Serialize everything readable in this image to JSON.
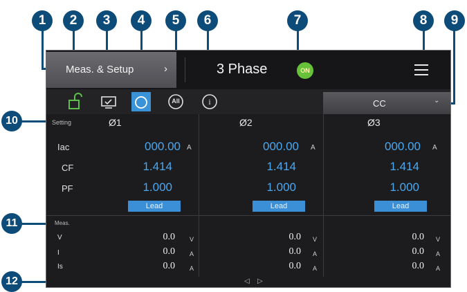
{
  "header": {
    "meas_setup_label": "Meas. & Setup",
    "chevron": "›",
    "title": "3 Phase",
    "on_badge": "ON"
  },
  "toolbar": {
    "icons": [
      "unlock-icon",
      "monitor-icon",
      "timer-icon",
      "all-icon",
      "info-icon"
    ],
    "all_label": "All",
    "info_label": "i",
    "mode_value": "CC",
    "mode_dropdown": "⌄"
  },
  "setting": {
    "section_label": "Setting",
    "row_labels": [
      "Iac",
      "CF",
      "PF"
    ],
    "phases": [
      {
        "name": "Ø1",
        "iac": "000.00",
        "iac_unit": "A",
        "cf": "1.414",
        "pf": "1.000",
        "lead": "Lead"
      },
      {
        "name": "Ø2",
        "iac": "000.00",
        "iac_unit": "A",
        "cf": "1.414",
        "pf": "1.000",
        "lead": "Lead"
      },
      {
        "name": "Ø3",
        "iac": "000.00",
        "iac_unit": "A",
        "cf": "1.414",
        "pf": "1.000",
        "lead": "Lead"
      }
    ]
  },
  "meas": {
    "section_label": "Meas.",
    "row_labels": [
      "V",
      "I",
      "Is"
    ],
    "phases": [
      {
        "v": "0.0",
        "v_unit": "V",
        "i": "0.0",
        "i_unit": "A",
        "is": "0.0",
        "is_unit": "A"
      },
      {
        "v": "0.0",
        "v_unit": "V",
        "i": "0.0",
        "i_unit": "A",
        "is": "0.0",
        "is_unit": "A"
      },
      {
        "v": "0.0",
        "v_unit": "V",
        "i": "0.0",
        "i_unit": "A",
        "is": "0.0",
        "is_unit": "A"
      }
    ]
  },
  "scroll": {
    "left": "◁",
    "right": "▷"
  },
  "callouts": [
    "1",
    "2",
    "3",
    "4",
    "5",
    "6",
    "7",
    "8",
    "9",
    "10",
    "11",
    "12"
  ],
  "colors": {
    "callout": "#0d4b79",
    "accent_blue": "#3a93d8",
    "on_green": "#67c23a"
  }
}
